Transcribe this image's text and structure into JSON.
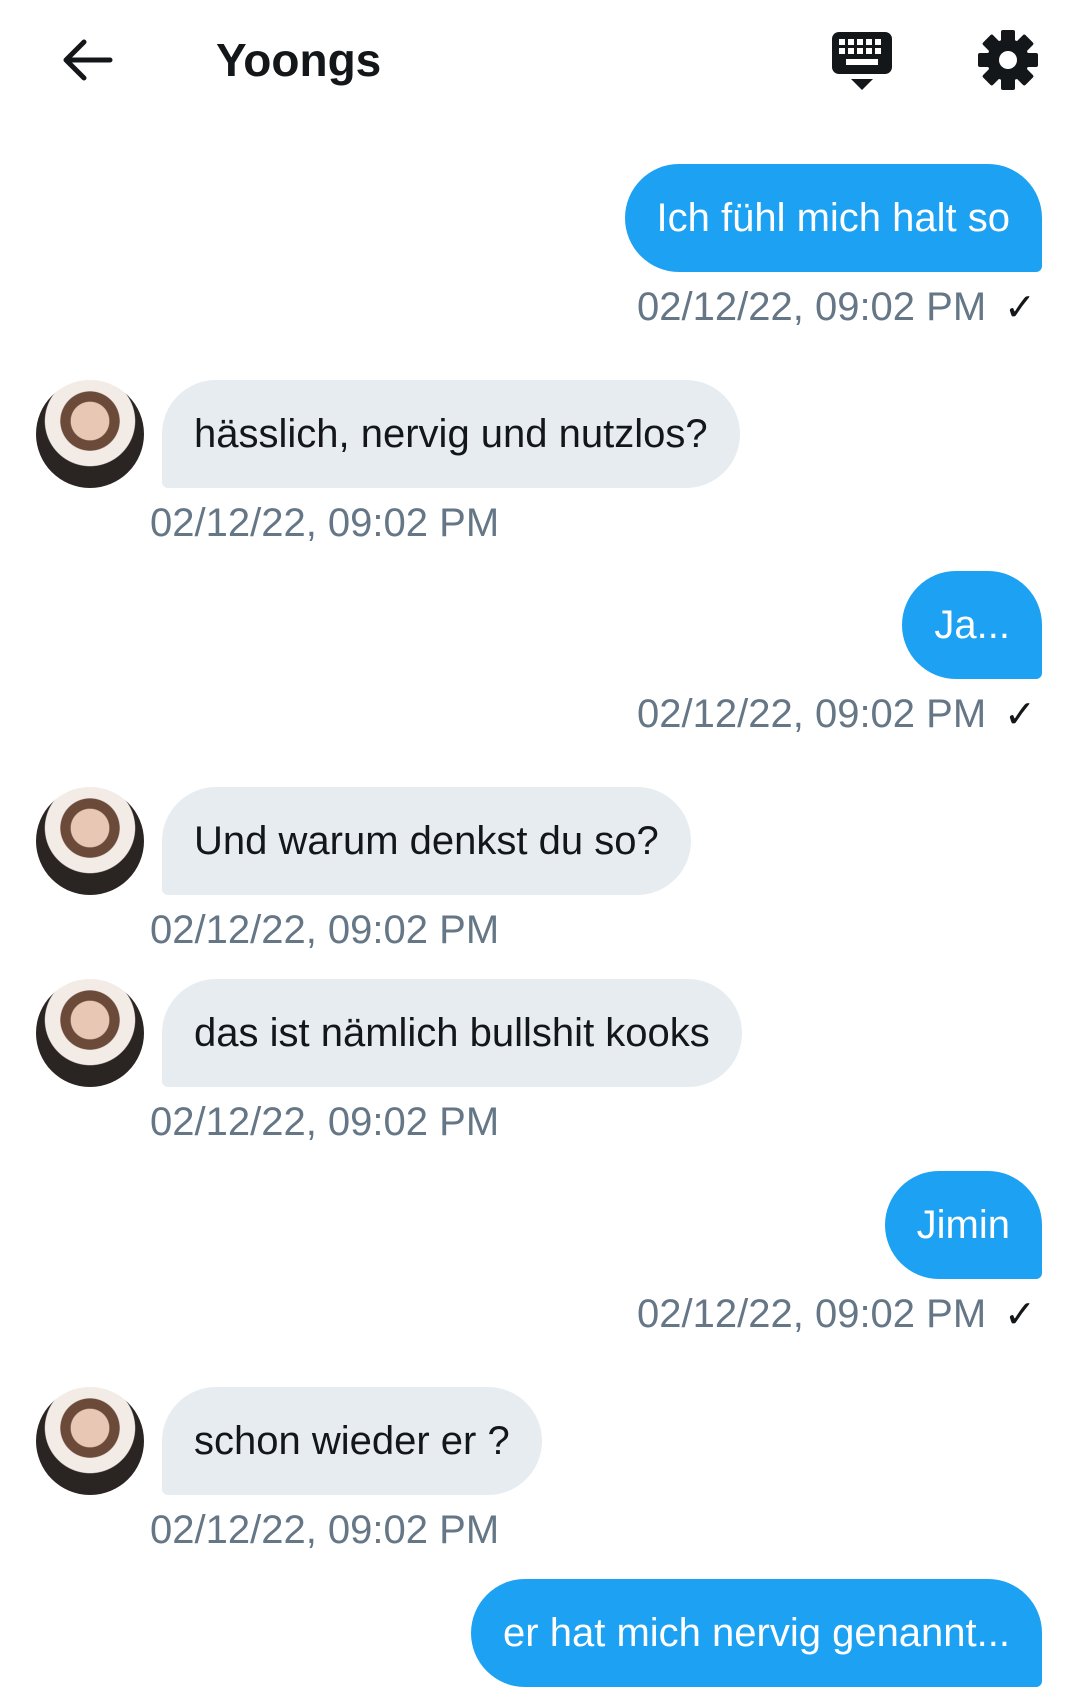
{
  "header": {
    "title": "Yoongs",
    "back_icon": "arrow-left-icon",
    "keyboard_icon": "keyboard-hide-icon",
    "settings_icon": "gear-icon"
  },
  "colors": {
    "outgoing_bubble": "#1da1f2",
    "incoming_bubble": "#e6ecf0",
    "timestamp": "#657786"
  },
  "messages": [
    {
      "direction": "out",
      "text": "Ich fühl mich halt so",
      "timestamp": "02/12/22, 09:02 PM",
      "read_mark": "✓"
    },
    {
      "direction": "in",
      "text": "hässlich, nervig und nutzlos?",
      "timestamp": "02/12/22, 09:02 PM"
    },
    {
      "direction": "out",
      "text": "Ja...",
      "timestamp": "02/12/22, 09:02 PM",
      "read_mark": "✓"
    },
    {
      "direction": "in",
      "text": "Und warum denkst du so?",
      "timestamp": "02/12/22, 09:02 PM"
    },
    {
      "direction": "in",
      "text": "das ist nämlich bullshit kooks",
      "timestamp": "02/12/22, 09:02 PM"
    },
    {
      "direction": "out",
      "text": "Jimin",
      "timestamp": "02/12/22, 09:02 PM",
      "read_mark": "✓"
    },
    {
      "direction": "in",
      "text": "schon wieder er ?",
      "timestamp": "02/12/22, 09:02 PM"
    },
    {
      "direction": "out",
      "text": "er hat mich nervig genannt...",
      "timestamp": ""
    }
  ]
}
